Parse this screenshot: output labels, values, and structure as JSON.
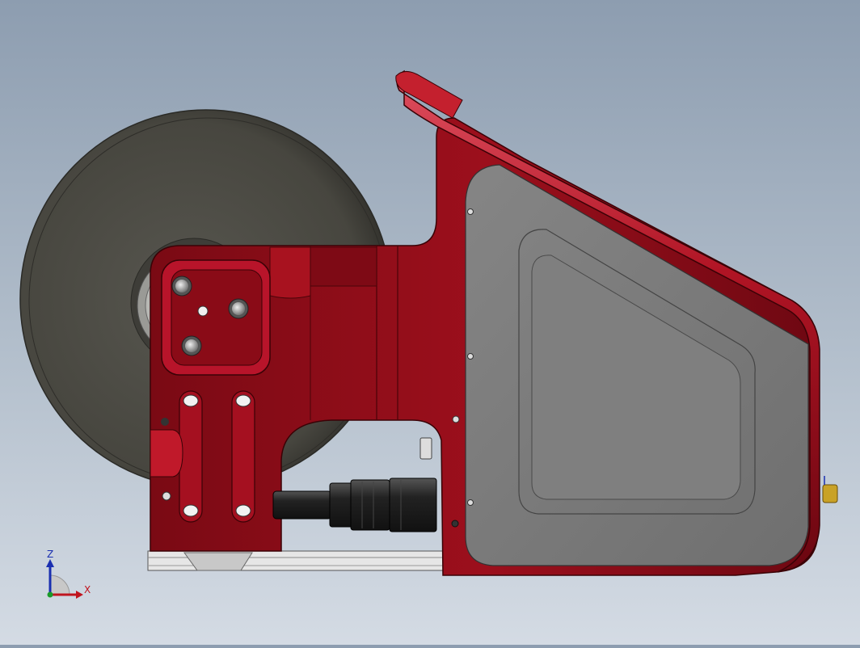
{
  "viewport": {
    "background_top": "#8d9db0",
    "background_bottom": "#d4dbe4"
  },
  "model": {
    "body_color": "#8e0c18",
    "body_highlight": "#c0202e",
    "panel_color": "#7a7a7a",
    "wheel_color": "#4a4a46",
    "base_rail_color": "#dcdcdc",
    "connector_color": "#1e1e1e",
    "brass_color": "#c9a227"
  },
  "triad": {
    "z_label": "Z",
    "x_label": "X",
    "z_color": "#1a2fb0",
    "x_color": "#c0141e",
    "y_color": "#1a9a2a"
  }
}
